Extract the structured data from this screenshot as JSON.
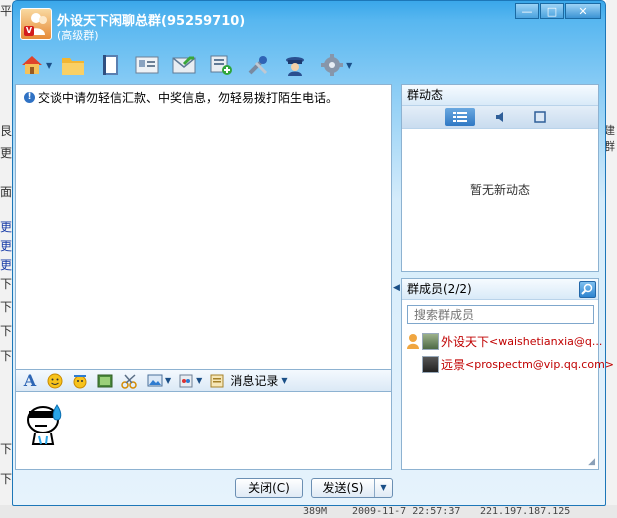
{
  "window": {
    "title": "外设天下闲聊总群(95259710)",
    "subtitle": "(高级群)",
    "controls": [
      "—",
      "□",
      "✕"
    ]
  },
  "toolbar": {
    "icons": [
      "home-icon",
      "folder-icon",
      "album-icon",
      "card-icon",
      "mail-icon",
      "share-icon",
      "tools-icon",
      "admin-icon",
      "settings-icon"
    ]
  },
  "chat": {
    "notice": "交谈中请勿轻信汇款、中奖信息，勿轻易拨打陌生电话。"
  },
  "format_bar": {
    "font_label": "A",
    "history_label": "消息记录"
  },
  "buttons": {
    "close": "关闭(C)",
    "send": "发送(S)"
  },
  "group_news": {
    "title": "群动态",
    "empty": "暂无新动态"
  },
  "members": {
    "title": "群成员(2/2)",
    "search_placeholder": "搜索群成员",
    "list": [
      {
        "name": "外设天下",
        "email": "<waishetianxia@q..."
      },
      {
        "name": "远景",
        "email": "<prospectm@vip.qq.com>"
      }
    ]
  },
  "background": {
    "left_fragments": [
      "平",
      "艮右",
      "更官",
      "面剥",
      "更新",
      "更新",
      "更新",
      "下设",
      "下设",
      "下设",
      "下设",
      "下设",
      "下设"
    ],
    "right_fragments": [
      "建群"
    ],
    "status_size": "389M",
    "status_time": "2009-11-7 22:57:37",
    "status_ip": "221.197.187.125"
  },
  "colors": {
    "accent": "#3aa7ea",
    "member_name": "#c00000"
  }
}
